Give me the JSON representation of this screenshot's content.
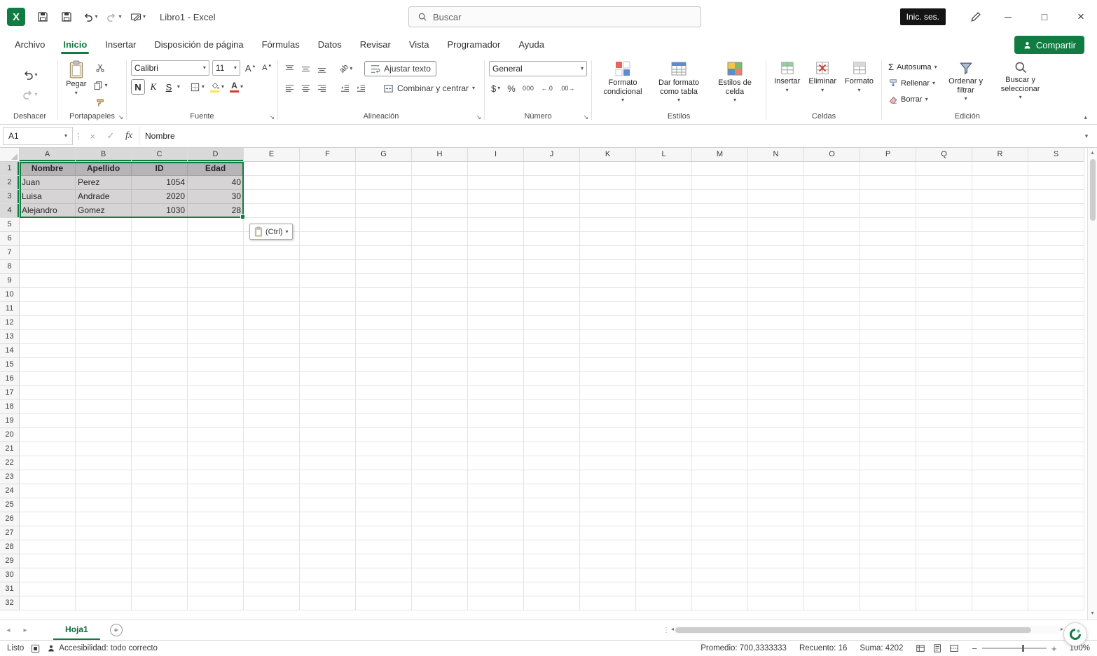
{
  "titlebar": {
    "title": "Libro1 - Excel",
    "search_placeholder": "Buscar",
    "sign_in": "Inic. ses."
  },
  "ribbon": {
    "tabs": [
      "Archivo",
      "Inicio",
      "Insertar",
      "Disposición de página",
      "Fórmulas",
      "Datos",
      "Revisar",
      "Vista",
      "Programador",
      "Ayuda"
    ],
    "active_tab": "Inicio",
    "share": "Compartir",
    "groups": {
      "undo": {
        "label": "Deshacer"
      },
      "clipboard": {
        "label": "Portapapeles",
        "paste": "Pegar"
      },
      "font": {
        "label": "Fuente",
        "name": "Calibri",
        "size": "11",
        "bold": "N",
        "italic": "K",
        "underline": "S",
        "grow": "A",
        "shrink": "A"
      },
      "alignment": {
        "label": "Alineación",
        "wrap": "Ajustar texto",
        "merge": "Combinar y centrar"
      },
      "number": {
        "label": "Número",
        "format": "General",
        "currency": "$",
        "percent": "%",
        "thousands": "000",
        "inc_decimal": "←.0",
        "dec_decimal": ".00→"
      },
      "styles": {
        "label": "Estilos",
        "conditional": "Formato condicional",
        "table": "Dar formato como tabla",
        "cell": "Estilos de celda"
      },
      "cells": {
        "label": "Celdas",
        "insert": "Insertar",
        "delete": "Eliminar",
        "format": "Formato"
      },
      "editing": {
        "label": "Edición",
        "autosum": "Autosuma",
        "fill": "Rellenar",
        "clear": "Borrar",
        "sort": "Ordenar y filtrar",
        "find": "Buscar y seleccionar"
      }
    }
  },
  "formula_bar": {
    "name_box": "A1",
    "fx": "fx",
    "value": "Nombre"
  },
  "sheet": {
    "columns": [
      "A",
      "B",
      "C",
      "D",
      "E",
      "F",
      "G",
      "H",
      "I",
      "J",
      "K",
      "L",
      "M",
      "N",
      "O",
      "P",
      "Q",
      "R",
      "S"
    ],
    "row_count": 32,
    "selection": {
      "range": "A1:D4",
      "rows": 4,
      "cols": 4
    },
    "cells": [
      [
        "Nombre",
        "Apellido",
        "ID",
        "Edad"
      ],
      [
        "Juan",
        "Perez",
        "1054",
        "40"
      ],
      [
        "Luisa",
        "Andrade",
        "2020",
        "30"
      ],
      [
        "Alejandro",
        "Gomez",
        "1030",
        "28"
      ]
    ],
    "paste_tag": "(Ctrl)"
  },
  "sheet_tabs": {
    "name": "Hoja1"
  },
  "status_bar": {
    "mode": "Listo",
    "accessibility": "Accesibilidad: todo correcto",
    "average": "Promedio: 700,3333333",
    "count": "Recuento: 16",
    "sum": "Suma: 4202",
    "zoom": "100%"
  },
  "colors": {
    "accent": "#107c41",
    "selection_fill": "#d7d4d5",
    "selection_header_fill": "#b7b4b5",
    "selected_rc_header": "#d9d9d9",
    "sign_in_badge": "#141414",
    "fill_color_swatch": "#f7e94a",
    "font_color_swatch": "#d83b2d"
  }
}
